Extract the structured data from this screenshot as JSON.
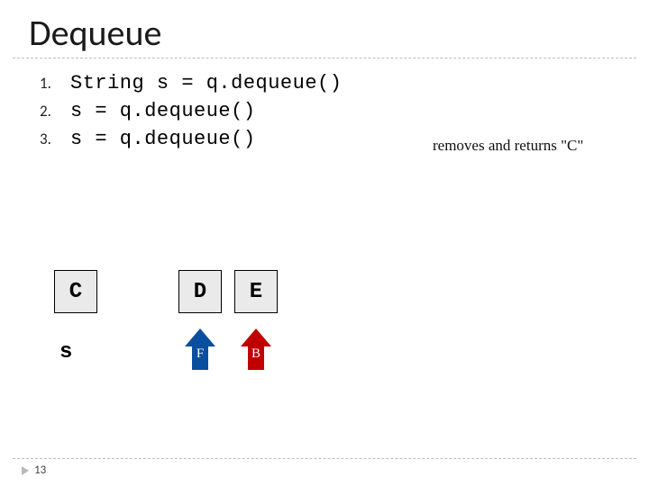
{
  "title": "Dequeue",
  "steps": [
    {
      "num": "1.",
      "code": "String s = q.dequeue()"
    },
    {
      "num": "2.",
      "code": "s = q.dequeue()"
    },
    {
      "num": "3.",
      "code": "s = q.dequeue()"
    }
  ],
  "annotation": "removes and returns \"C\"",
  "boxes": {
    "c": "C",
    "d": "D",
    "e": "E"
  },
  "var_label": "s",
  "arrows": {
    "front": "F",
    "back": "B"
  },
  "page_number": "13"
}
